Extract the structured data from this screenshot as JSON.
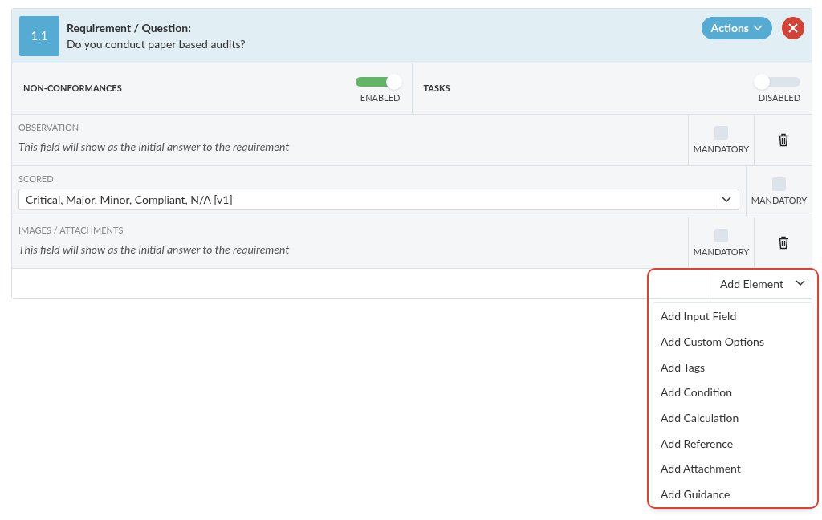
{
  "question": {
    "number": "1.1",
    "label": "Requirement / Question:",
    "text": "Do you conduct paper based audits?",
    "actions_button": "Actions"
  },
  "toggles": [
    {
      "label": "NON-CONFORMANCES",
      "on": true,
      "state_text": "ENABLED"
    },
    {
      "label": "TASKS",
      "on": false,
      "state_text": "DISABLED"
    }
  ],
  "elements": [
    {
      "kind": "text",
      "title": "OBSERVATION",
      "hint": "This field will show as the initial answer to the requirement",
      "mandatory_label": "MANDATORY",
      "checked": false,
      "deletable": true
    },
    {
      "kind": "select",
      "title": "SCORED",
      "value": "Critical, Major, Minor, Compliant, N/A [v1]",
      "mandatory_label": "MANDATORY",
      "checked": false,
      "deletable": false
    },
    {
      "kind": "text",
      "title": "IMAGES / ATTACHMENTS",
      "hint": "This field will show as the initial answer to the requirement",
      "mandatory_label": "MANDATORY",
      "checked": false,
      "deletable": true
    }
  ],
  "add_element": {
    "label": "Add Element",
    "expanded": true,
    "highlighted": true,
    "menu": [
      "Add Input Field",
      "Add Custom Options",
      "Add Tags",
      "Add Condition",
      "Add Calculation",
      "Add Reference",
      "Add Attachment",
      "Add Guidance"
    ]
  }
}
